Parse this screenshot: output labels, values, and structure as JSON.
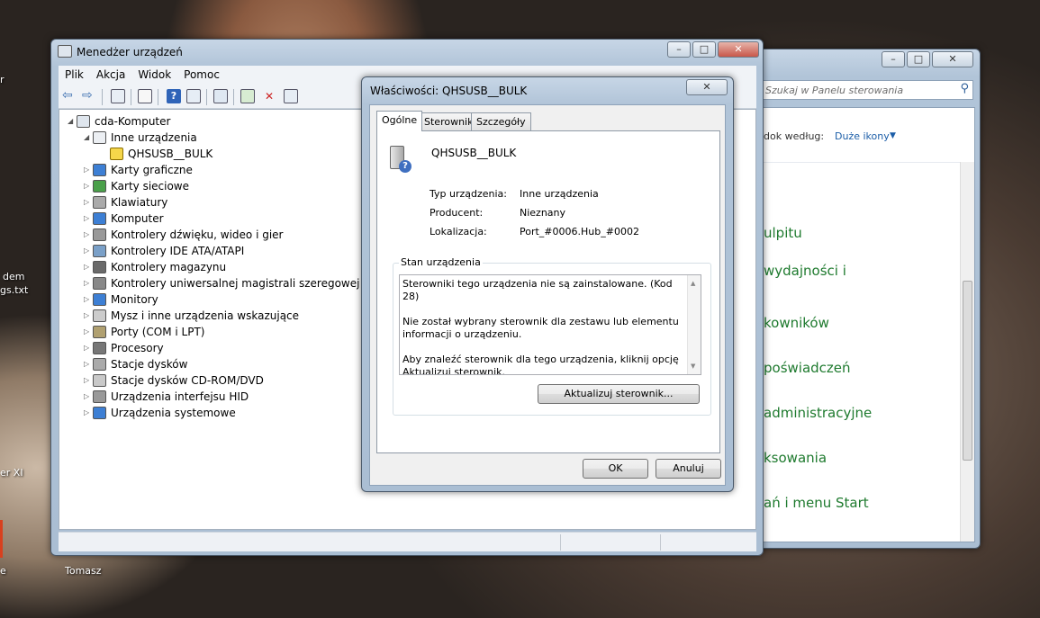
{
  "desktop": {
    "labels": [
      "r",
      "dem",
      "gs.txt",
      "er XI",
      "e",
      "Tomasz"
    ]
  },
  "control_panel": {
    "search_placeholder": "Szukaj w Panelu sterowania",
    "view_by_label": "dok według:",
    "view_by_value": "Duże ikony",
    "items": [
      "ulpitu",
      "wydajności i",
      "kowników",
      "poświadczeń",
      "administracyjne",
      "ksowania",
      "ań i menu Start"
    ],
    "buttons": {
      "min": "–",
      "max": "□",
      "close": "✕"
    }
  },
  "device_manager": {
    "title": "Menedżer urządzeń",
    "menu": [
      "Plik",
      "Akcja",
      "Widok",
      "Pomoc"
    ],
    "buttons": {
      "min": "–",
      "max": "□",
      "close": "✕"
    },
    "tree": {
      "root": "cda-Komputer",
      "other_devices": "Inne urządzenia",
      "selected_device": "QHSUSB__BULK",
      "categories": [
        "Karty graficzne",
        "Karty sieciowe",
        "Klawiatury",
        "Komputer",
        "Kontrolery dźwięku, wideo i gier",
        "Kontrolery IDE ATA/ATAPI",
        "Kontrolery magazynu",
        "Kontrolery uniwersalnej magistrali szeregowej",
        "Monitory",
        "Mysz i inne urządzenia wskazujące",
        "Porty (COM i LPT)",
        "Procesory",
        "Stacje dysków",
        "Stacje dysków CD-ROM/DVD",
        "Urządzenia interfejsu HID",
        "Urządzenia systemowe"
      ]
    }
  },
  "dialog": {
    "title": "Właściwości: QHSUSB__BULK",
    "close": "✕",
    "tabs": [
      "Ogólne",
      "Sterownik",
      "Szczegóły"
    ],
    "device_name": "QHSUSB__BULK",
    "props": {
      "type_label": "Typ urządzenia:",
      "type_value": "Inne urządzenia",
      "manufacturer_label": "Producent:",
      "manufacturer_value": "Nieznany",
      "location_label": "Lokalizacja:",
      "location_value": "Port_#0006.Hub_#0002"
    },
    "status_group": "Stan urządzenia",
    "status_lines": [
      "Sterowniki tego urządzenia nie są zainstalowane. (Kod 28)",
      "Nie został wybrany sterownik dla zestawu lub elementu informacji o urządzeniu.",
      "Aby znaleźć sterownik dla tego urządzenia, kliknij opcję Aktualizuj sterownik."
    ],
    "update_button": "Aktualizuj sterownik...",
    "ok": "OK",
    "cancel": "Anuluj"
  }
}
